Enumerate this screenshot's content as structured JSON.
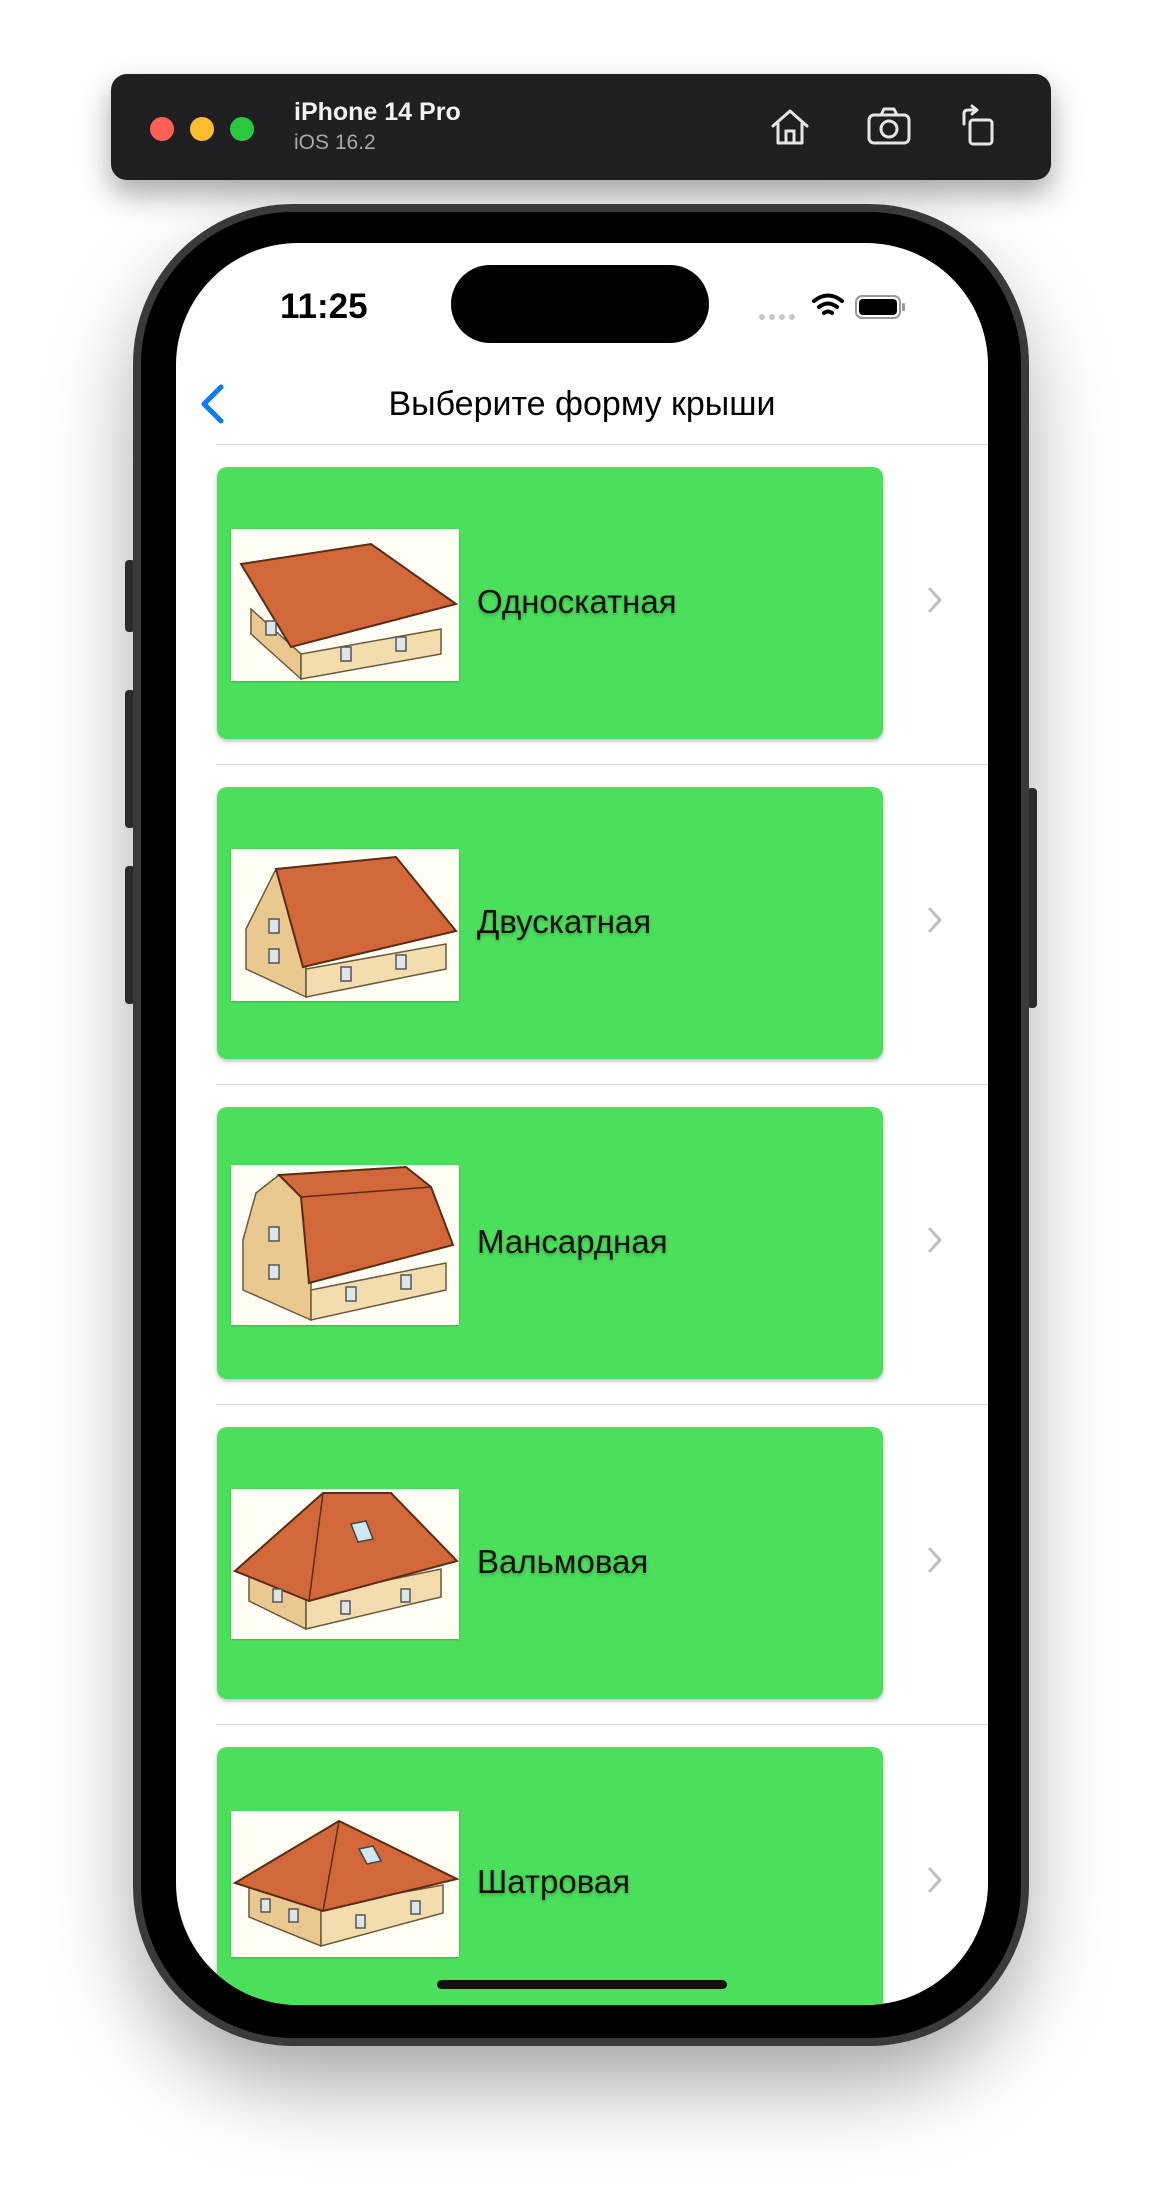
{
  "simulator": {
    "device_name": "iPhone 14 Pro",
    "os_version": "iOS 16.2",
    "buttons": [
      "home-icon",
      "screenshot-icon",
      "rotate-icon"
    ]
  },
  "status_bar": {
    "time": "11:25",
    "icons": [
      "signal-icon",
      "wifi-icon",
      "battery-icon"
    ]
  },
  "nav": {
    "back_icon": "chevron-left-icon",
    "title": "Выберите форму крыши"
  },
  "roof_types": [
    {
      "label": "Односкатная",
      "image": "mono-pitch-roof-house"
    },
    {
      "label": "Двускатная",
      "image": "gable-roof-house"
    },
    {
      "label": "Мансардная",
      "image": "mansard-roof-house"
    },
    {
      "label": "Вальмовая",
      "image": "hip-roof-house"
    },
    {
      "label": "Шатровая",
      "image": "pyramid-roof-house"
    }
  ],
  "colors": {
    "card_green": "#4cdf5b",
    "roof_orange": "#d2683a",
    "wall_beige": "#f3dcae",
    "ios_blue": "#0a7aff"
  }
}
